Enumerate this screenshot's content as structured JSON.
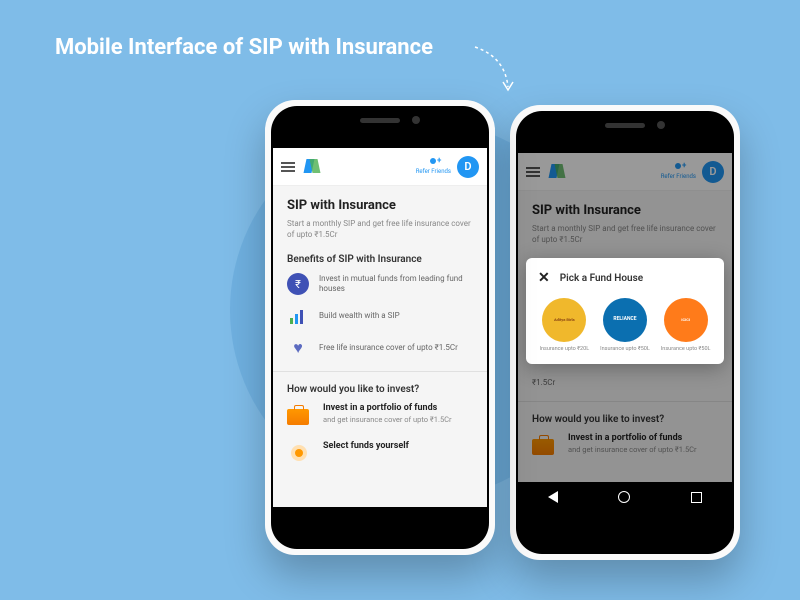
{
  "hero": {
    "title": "Mobile Interface of SIP with Insurance"
  },
  "topbar": {
    "refer_label": "Refer Friends",
    "avatar_letter": "D"
  },
  "page": {
    "title": "SIP with Insurance",
    "subtitle": "Start a monthly SIP and get free life insurance cover of upto ₹1.5Cr"
  },
  "benefits": {
    "heading": "Benefits of SIP with Insurance",
    "items": [
      {
        "text": "Invest in mutual funds from leading fund houses"
      },
      {
        "text": "Build wealth with a SIP"
      },
      {
        "text": "Free life insurance cover of upto ₹1.5Cr"
      }
    ]
  },
  "invest": {
    "heading": "How would you like to invest?",
    "options": [
      {
        "title": "Invest in a portfolio of funds",
        "sub": "and get insurance cover of upto ₹1.5Cr"
      },
      {
        "title": "Select funds yourself",
        "sub": ""
      }
    ]
  },
  "modal": {
    "title": "Pick a Fund House",
    "funds": [
      {
        "name": "Aditya Birla Sun Life Mutual Fund",
        "label": "Insurance upto ₹20L",
        "color": "#f0b82c"
      },
      {
        "name": "RELIANCE",
        "label": "Insurance upto ₹50L",
        "color": "#0b6fb0"
      },
      {
        "name": "ICICI Prudential",
        "label": "Insurance upto ₹50L",
        "color": "#ff7b1a"
      }
    ]
  },
  "right_screen": {
    "visible_line": "₹1.5Cr"
  }
}
